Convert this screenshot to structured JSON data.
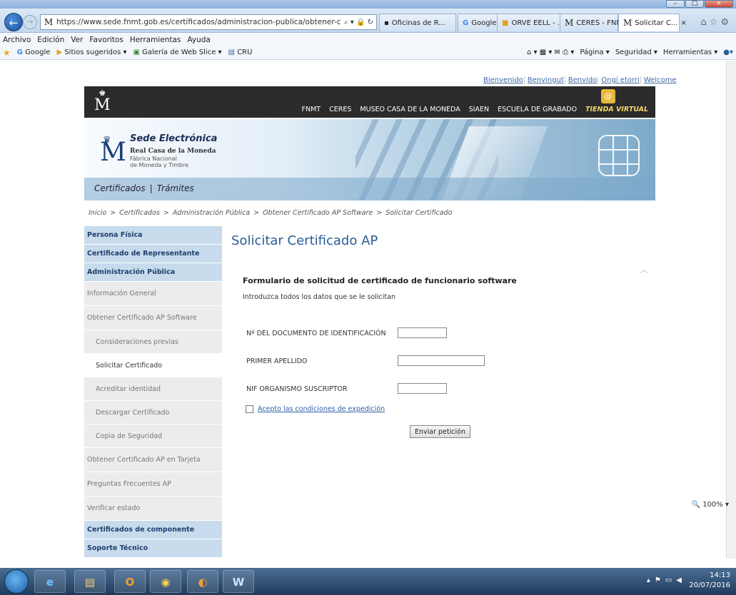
{
  "browser": {
    "url": "https://www.sede.fnmt.gob.es/certificados/administracion-publica/obtener-certificado-",
    "tabs": [
      {
        "label": "Oficinas de R..."
      },
      {
        "label": "Google"
      },
      {
        "label": "ORVE EELL - ..."
      },
      {
        "label": "CERES - FNMT"
      },
      {
        "label": "Solicitar C...",
        "close": "×"
      }
    ],
    "menu": [
      "Archivo",
      "Edición",
      "Ver",
      "Favoritos",
      "Herramientas",
      "Ayuda"
    ],
    "favorites": [
      "Google",
      "Sitios sugeridos ▾",
      "Galería de Web Slice ▾",
      "CRU"
    ],
    "toolbar_right": [
      "Página ▾",
      "Seguridad ▾",
      "Herramientas ▾"
    ],
    "zoom": "100%"
  },
  "site": {
    "lang_links": [
      "Bienvenido",
      "Benvingut",
      "Benvido",
      "Ongi etorri",
      "Welcome"
    ],
    "top_nav": [
      "FNMT",
      "CERES",
      "MUSEO CASA DE LA MONEDA",
      "SIAEN",
      "ESCUELA DE GRABADO",
      "TIENDA VIRTUAL"
    ],
    "logo": {
      "title": "Sede Electrónica",
      "line1": "Real Casa de la Moneda",
      "line2": "Fábrica Nacional",
      "line3": "de Moneda y Timbre"
    },
    "sections": [
      "Certificados",
      "|",
      "Trámites"
    ],
    "breadcrumb": [
      "Inicio",
      ">",
      "Certificados",
      ">",
      "Administración Pública",
      ">",
      "Obtener Certificado AP Software",
      ">",
      "Solicitar Certificado"
    ]
  },
  "sidebar": [
    {
      "label": "Persona Física",
      "kind": "head"
    },
    {
      "label": "Certificado de Representante",
      "kind": "head"
    },
    {
      "label": "Administración Pública",
      "kind": "head"
    },
    {
      "label": "Información General",
      "kind": "item"
    },
    {
      "label": "Obtener Certificado AP Software",
      "kind": "item"
    },
    {
      "label": "Consideraciones previas",
      "kind": "sub"
    },
    {
      "label": "Solicitar Certificado",
      "kind": "sub-selected"
    },
    {
      "label": "Acreditar identidad",
      "kind": "sub"
    },
    {
      "label": "Descargar Certificado",
      "kind": "sub"
    },
    {
      "label": "Copia de Seguridad",
      "kind": "sub"
    },
    {
      "label": "Obtener Certificado AP en Tarjeta",
      "kind": "item"
    },
    {
      "label": "Preguntas Frecuentes AP",
      "kind": "item"
    },
    {
      "label": "Verificar estado",
      "kind": "item"
    },
    {
      "label": "Certificados de componente",
      "kind": "head"
    },
    {
      "label": "Soporte Técnico",
      "kind": "head"
    }
  ],
  "main": {
    "title": "Solicitar Certificado AP",
    "form_title": "Formulario de solicitud de certificado de funcionario software",
    "form_subtitle": "Introduzca todos los datos que se le solicitan",
    "fields": [
      {
        "label": "Nº DEL DOCUMENTO DE IDENTIFICACIÓN",
        "value": ""
      },
      {
        "label": "PRIMER APELLIDO",
        "value": ""
      },
      {
        "label": "NIF ORGANISMO SUSCRIPTOR",
        "value": ""
      }
    ],
    "accept_label": "Acepto las condiciones de expedición",
    "submit_label": "Enviar petición"
  },
  "taskbar": {
    "time": "14:13",
    "date": "20/07/2016"
  }
}
